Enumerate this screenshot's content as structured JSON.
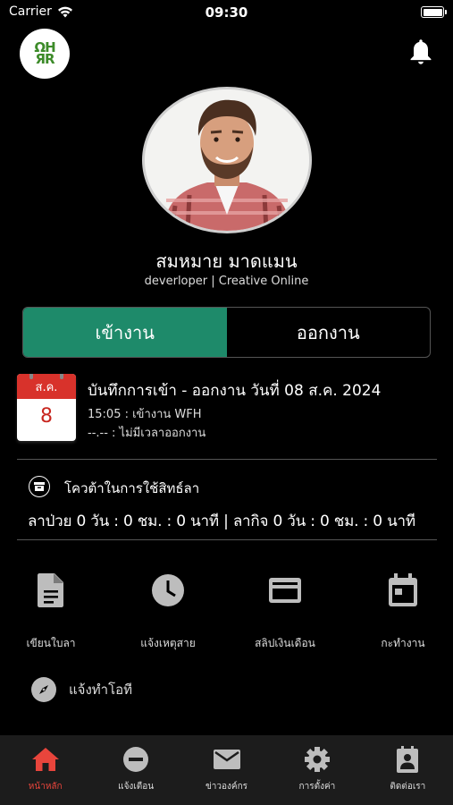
{
  "status_bar": {
    "carrier": "Carrier",
    "time": "09:30"
  },
  "header": {
    "logo_text_top": "ΩH",
    "logo_text_bottom": "ЯR"
  },
  "profile": {
    "name": "สมหมาย มาดแมน",
    "role": "deverloper | Creative Online"
  },
  "segmented": {
    "check_in": "เข้างาน",
    "check_out": "ออกงาน",
    "active": "check_in",
    "active_color": "#1e8a6a"
  },
  "record": {
    "calendar_month": "ส.ค.",
    "calendar_day": "8",
    "title": "บันทึกการเข้า - ออกงาน วันที่ 08 ส.ค. 2024",
    "check_in_line": "15:05 : เข้างาน  WFH",
    "check_out_line": "--.-- : ไม่มีเวลาออกงาน"
  },
  "quota": {
    "label": "โควต้าในการใช้สิทธ์ลา",
    "summary": "ลาป่วย 0 วัน : 0 ชม. : 0 นาที  | ลากิจ 0 วัน : 0 ชม. : 0 นาที"
  },
  "menu": [
    {
      "label": "เขียนใบลา",
      "icon": "document-icon"
    },
    {
      "label": "แจ้งเหตุสาย",
      "icon": "clock-icon"
    },
    {
      "label": "สลิปเงินเดือน",
      "icon": "credit-card-icon"
    },
    {
      "label": "กะทำงาน",
      "icon": "calendar-icon"
    }
  ],
  "overtime": {
    "label": "แจ้งทำโอที",
    "icon": "compass-icon"
  },
  "tabbar": [
    {
      "label": "หน้าหลัก",
      "icon": "home-icon",
      "active": true
    },
    {
      "label": "แจ้งเตือน",
      "icon": "minus-circle-icon",
      "active": false
    },
    {
      "label": "ข่าวองค์กร",
      "icon": "mail-icon",
      "active": false
    },
    {
      "label": "การตั้งค่า",
      "icon": "gear-icon",
      "active": false
    },
    {
      "label": "ติดต่อเรา",
      "icon": "contact-card-icon",
      "active": false
    }
  ],
  "colors": {
    "accent": "#1e8a6a",
    "tab_active": "#e8453c",
    "calendar_red": "#d8322b",
    "icon_gray": "#bdbdbd"
  }
}
